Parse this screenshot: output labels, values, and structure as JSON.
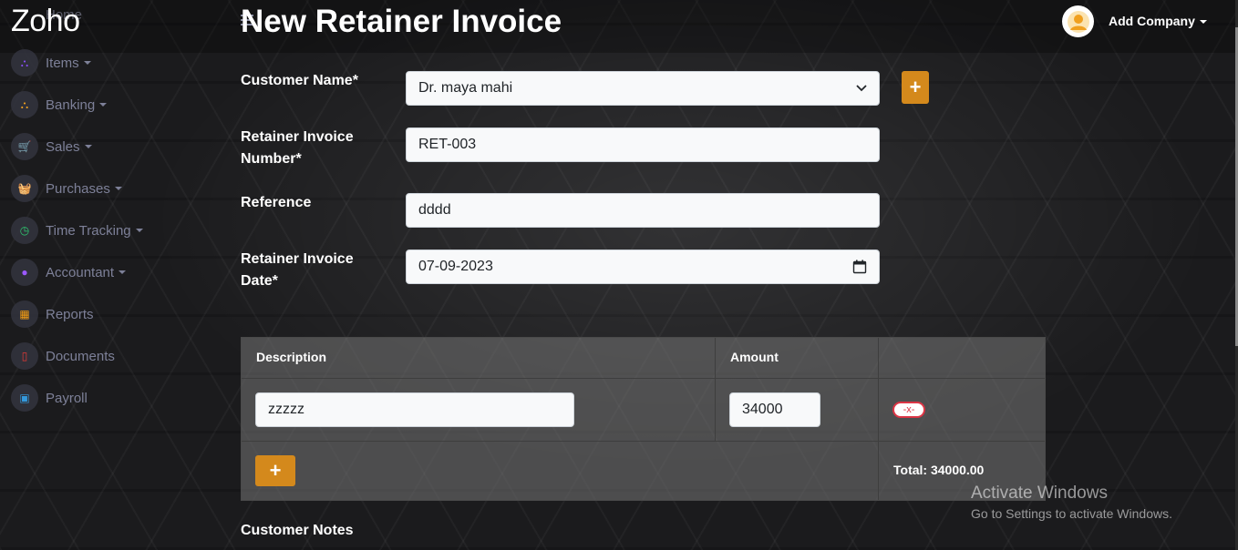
{
  "brand": "Zoho",
  "sidebar": {
    "partial_top_item": "Home",
    "items": [
      {
        "label": "Items",
        "icon": "sitemap-icon",
        "icon_color": "#8a4fff",
        "glyph": "⛬",
        "has_caret": true
      },
      {
        "label": "Banking",
        "icon": "sitemap-icon",
        "icon_color": "#f0a020",
        "glyph": "⛬",
        "has_caret": true
      },
      {
        "label": "Sales",
        "icon": "cart-icon",
        "icon_color": "#e53935",
        "glyph": "🛒",
        "has_caret": true
      },
      {
        "label": "Purchases",
        "icon": "basket-icon",
        "icon_color": "#2196f3",
        "glyph": "🧺",
        "has_caret": true
      },
      {
        "label": "Time Tracking",
        "icon": "clock-icon",
        "icon_color": "#2ecc71",
        "glyph": "◷",
        "has_caret": true
      },
      {
        "label": "Accountant",
        "icon": "user-icon",
        "icon_color": "#9b59ff",
        "glyph": "●",
        "has_caret": true
      },
      {
        "label": "Reports",
        "icon": "calendar-icon",
        "icon_color": "#f39c12",
        "glyph": "▦",
        "has_caret": false
      },
      {
        "label": "Documents",
        "icon": "file-icon",
        "icon_color": "#e53935",
        "glyph": "▯",
        "has_caret": false
      },
      {
        "label": "Payroll",
        "icon": "money-icon",
        "icon_color": "#3498db",
        "glyph": "▣",
        "has_caret": false
      }
    ]
  },
  "header": {
    "title": "New Retainer Invoice",
    "company_label": "Add Company"
  },
  "form": {
    "customer_name_label": "Customer Name*",
    "customer_name_value": "Dr. maya mahi",
    "invoice_number_label_line1": "Retainer Invoice",
    "invoice_number_label_line2": "Number*",
    "invoice_number_value": "RET-003",
    "reference_label": "Reference",
    "reference_value": "dddd",
    "date_label_line1": "Retainer Invoice",
    "date_label_line2": "Date*",
    "date_value": "07-09-2023"
  },
  "table": {
    "headers": [
      "Description",
      "Amount",
      ""
    ],
    "rows": [
      {
        "description": "zzzzz",
        "amount": "34000",
        "remove_label": "-x-"
      }
    ],
    "add_label": "+",
    "total": "Total: 34000.00"
  },
  "notes_label": "Customer Notes",
  "watermark": {
    "title": "Activate Windows",
    "subtitle": "Go to Settings to activate Windows."
  },
  "colors": {
    "accent": "#d4891c",
    "danger": "#dc3545"
  }
}
